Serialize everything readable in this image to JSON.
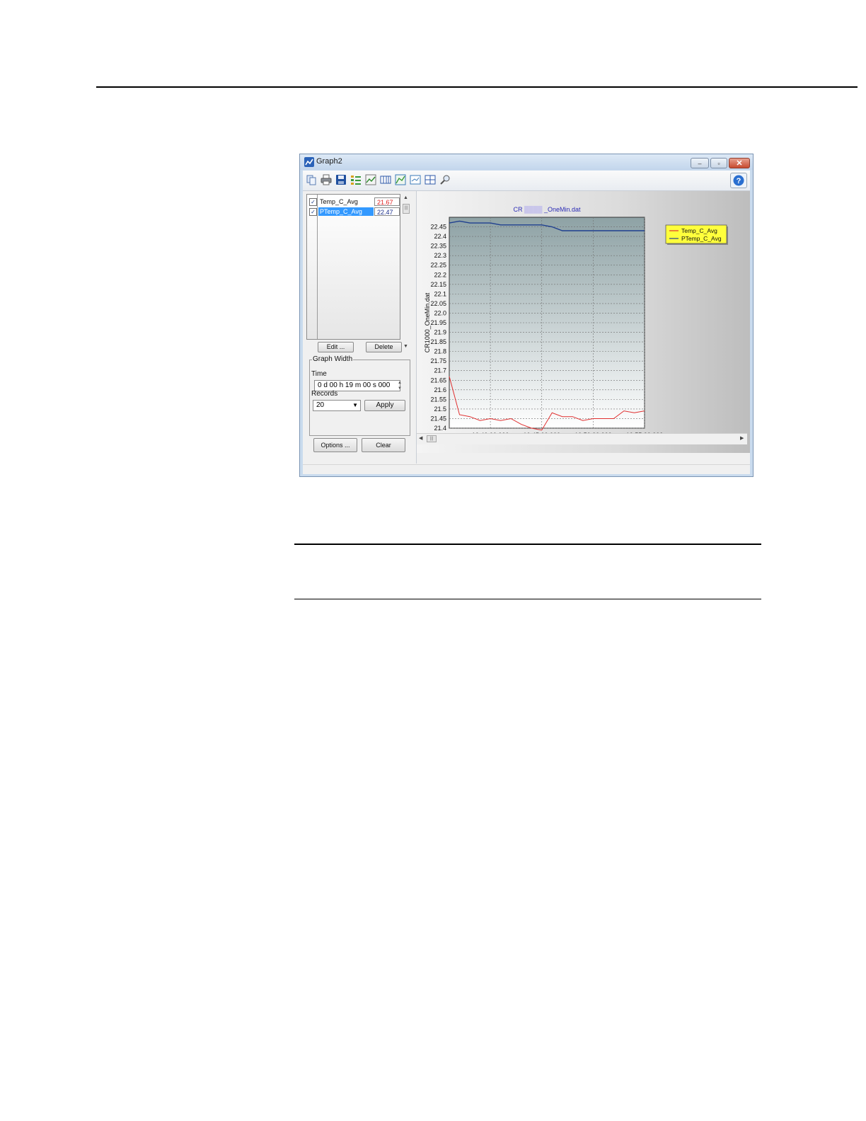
{
  "window": {
    "title": "Graph2"
  },
  "titlebar_buttons": {
    "minimize": "‒",
    "maximize": "▫",
    "close": "✕"
  },
  "toolbar": {
    "tools": [
      "copy-icon",
      "print-icon",
      "save-icon",
      "trace-list-icon",
      "chart-icon",
      "table-icon",
      "scale-icon",
      "graph-icon",
      "layout-icon",
      "zoom-icon"
    ],
    "help": "?"
  },
  "traces": [
    {
      "name": "Temp_C_Avg",
      "value": "21.67",
      "value_color": "#e02020",
      "checked": "✓"
    },
    {
      "name": "PTemp_C_Avg",
      "value": "22.47",
      "value_color": "#1a2e8c",
      "checked": "✓"
    }
  ],
  "buttons": {
    "edit": "Edit ...",
    "delete": "Delete",
    "options": "Options ...",
    "clear": "Clear",
    "apply": "Apply"
  },
  "graph_width": {
    "legend": "Graph Width",
    "time_label": "Time",
    "time_value": "0 d 00 h 19 m 00 s 000",
    "records_label": "Records",
    "records_value": "20"
  },
  "chart_data": {
    "type": "line",
    "title": "CR",
    "title_suffix": "_OneMin.dat",
    "ylabel": "CR1000_OneMin.dat",
    "xlabel": "",
    "ylim": [
      21.4,
      22.5
    ],
    "yticks": [
      "22.45",
      "22.4",
      "22.35",
      "22.3",
      "22.25",
      "22.2",
      "22.15",
      "22.1",
      "22.05",
      "22.0",
      "21.95",
      "21.9",
      "21.85",
      "21.8",
      "21.75",
      "21.7",
      "21.65",
      "21.6",
      "21.55",
      "21.5",
      "21.45",
      "21.4"
    ],
    "xlim": [
      0,
      19
    ],
    "xticks": [
      {
        "x": 4,
        "label": "10:40:00.000"
      },
      {
        "x": 9,
        "label": "10:45:00.000"
      },
      {
        "x": 14,
        "label": "10:50:00.000"
      },
      {
        "x": 19,
        "label": "10:55:00.000"
      }
    ],
    "grid": true,
    "legend_position": "top-right",
    "series": [
      {
        "name": "Temp_C_Avg",
        "color": "#e03030",
        "x": [
          0,
          1,
          2,
          3,
          4,
          5,
          6,
          7,
          8,
          9,
          10,
          11,
          12,
          13,
          14,
          15,
          16,
          17,
          18,
          19
        ],
        "values": [
          21.67,
          21.47,
          21.46,
          21.44,
          21.45,
          21.44,
          21.45,
          21.42,
          21.4,
          21.39,
          21.48,
          21.46,
          21.46,
          21.44,
          21.45,
          21.45,
          21.45,
          21.49,
          21.48,
          21.49
        ]
      },
      {
        "name": "PTemp_C_Avg",
        "color": "#1f3f8f",
        "x": [
          0,
          1,
          2,
          3,
          4,
          5,
          6,
          7,
          8,
          9,
          10,
          11,
          12,
          13,
          14,
          15,
          16,
          17,
          18,
          19
        ],
        "values": [
          22.47,
          22.48,
          22.47,
          22.47,
          22.47,
          22.46,
          22.46,
          22.46,
          22.46,
          22.46,
          22.45,
          22.43,
          22.43,
          22.43,
          22.43,
          22.43,
          22.43,
          22.43,
          22.43,
          22.43
        ]
      }
    ]
  },
  "scrollbars": {
    "up": "▲",
    "down": "▼",
    "left": "◀",
    "right": "▶",
    "grip": "|||"
  }
}
